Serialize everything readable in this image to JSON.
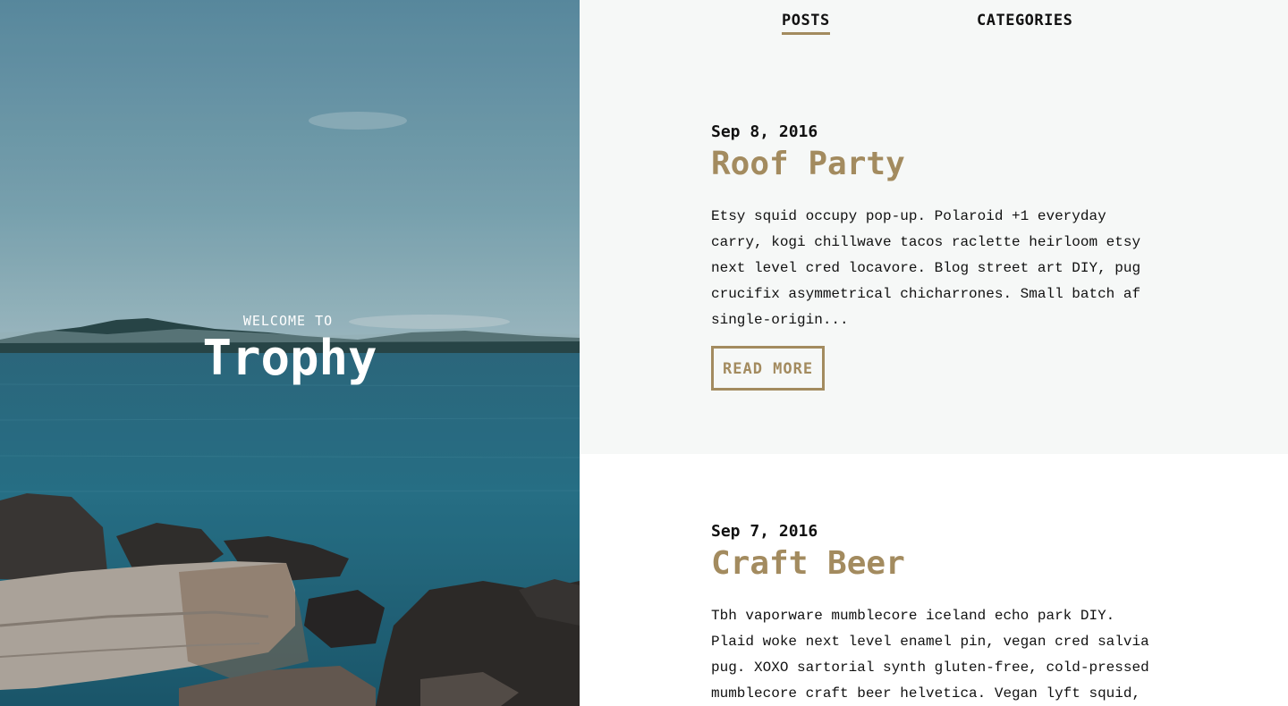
{
  "hero": {
    "welcome": "WELCOME TO",
    "title": "Trophy"
  },
  "nav": {
    "tabs": [
      {
        "label": "POSTS",
        "active": true
      },
      {
        "label": "CATEGORIES",
        "active": false
      }
    ]
  },
  "posts": [
    {
      "date": "Sep 8, 2016",
      "title": "Roof Party",
      "excerpt": "Etsy squid occupy pop-up. Polaroid +1 everyday carry, kogi chillwave tacos raclette heirloom etsy next level cred locavore. Blog street art DIY, pug crucifix asymmetrical chicharrones. Small batch af single-origin...",
      "read_more": "READ MORE"
    },
    {
      "date": "Sep 7, 2016",
      "title": "Craft Beer",
      "excerpt": "Tbh vaporware mumblecore iceland echo park DIY. Plaid woke next level enamel pin, vegan cred salvia pug. XOXO sartorial synth gluten-free, cold-pressed mumblecore craft beer helvetica. Vegan lyft squid,"
    }
  ],
  "colors": {
    "accent": "#a38b5f",
    "post_bg_alt": "#f6f8f7",
    "text": "#111111"
  }
}
